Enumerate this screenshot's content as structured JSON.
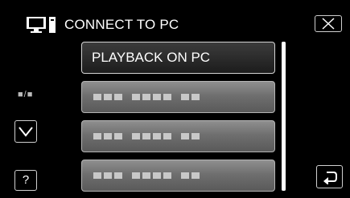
{
  "header": {
    "icon": "pc-monitor-icon",
    "title": "CONNECT TO PC",
    "close_icon": "close-icon"
  },
  "menu": {
    "items": [
      {
        "label": "PLAYBACK ON PC",
        "selected": true
      },
      {
        "label": "",
        "selected": false
      },
      {
        "label": "",
        "selected": false
      },
      {
        "label": "",
        "selected": false
      }
    ]
  },
  "sidebar": {
    "page_indicator": "■/■",
    "down_icon": "chevron-down-icon",
    "help_label": "?"
  },
  "footer": {
    "back_icon": "return-icon"
  },
  "colors": {
    "background": "#000000",
    "item_inactive": "#6f6f6f",
    "item_active": "#1c1c1c",
    "text": "#ffffff"
  }
}
